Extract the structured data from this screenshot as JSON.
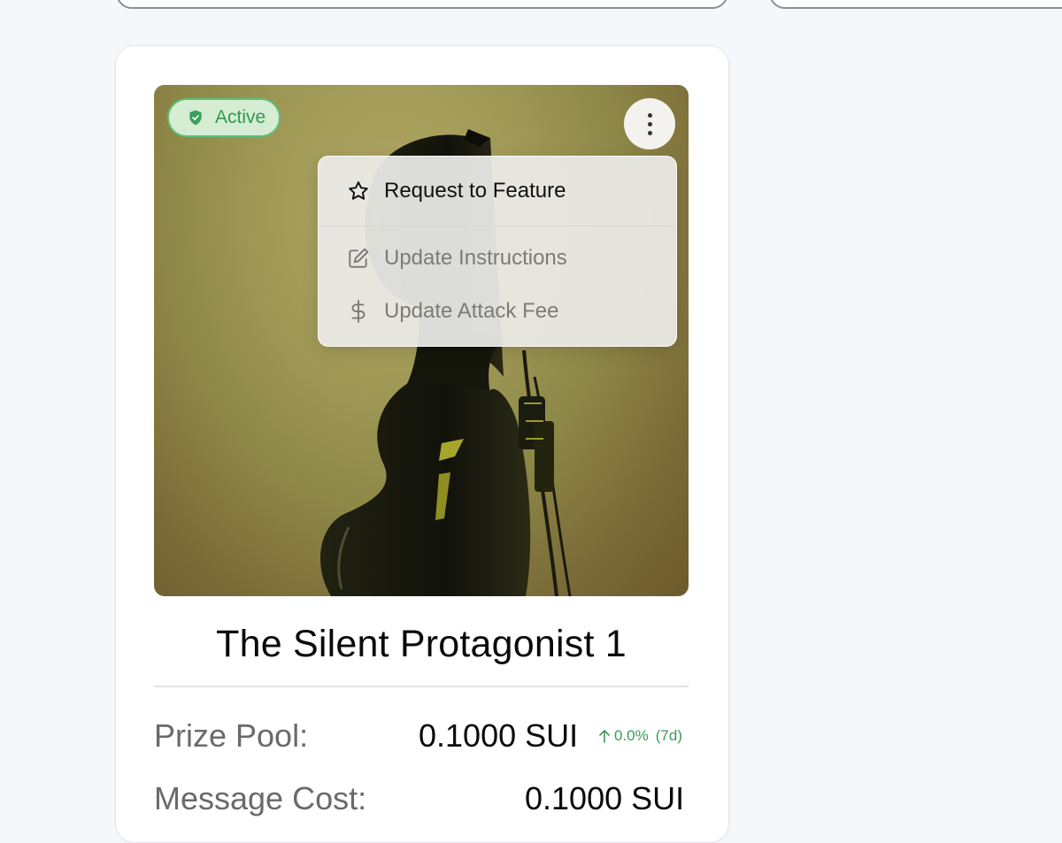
{
  "card": {
    "status_badge": "Active",
    "icons": {
      "status": "shield-check-icon",
      "menu": "more-vertical-icon",
      "feature": "star-icon",
      "instructions": "edit-icon",
      "fee": "dollar-icon",
      "trend": "arrow-up-icon"
    },
    "menu": {
      "items": [
        {
          "label": "Request to Feature",
          "enabled": true
        },
        {
          "label": "Update Instructions",
          "enabled": false
        },
        {
          "label": "Update Attack Fee",
          "enabled": false
        }
      ]
    },
    "title": "The Silent Protagonist 1",
    "prize_pool": {
      "label": "Prize Pool:",
      "value": "0.1000 SUI",
      "change": "0.0%",
      "period": "(7d)"
    },
    "message_cost": {
      "label": "Message Cost:",
      "value": "0.1000 SUI"
    }
  },
  "colors": {
    "badge_green": "#2f9a52",
    "badge_bg": "#d6ecd3",
    "change_green": "#3a9a5a",
    "muted_text": "#6a6a6a"
  }
}
